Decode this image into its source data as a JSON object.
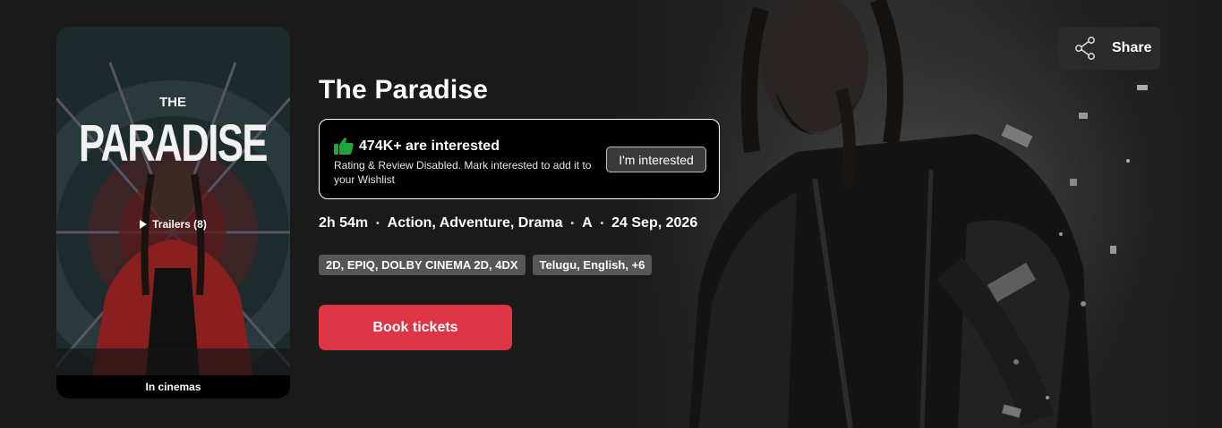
{
  "movie": {
    "title": "The Paradise",
    "poster": {
      "title_top": "THE",
      "title_main": "PARADISE",
      "trailers_label": "Trailers (8)",
      "footer_label": "In cinemas"
    },
    "interest": {
      "count_text": "474K+ are interested",
      "description": "Rating & Review Disabled. Mark interested to add it to your Wishlist",
      "button_label": "I'm interested"
    },
    "meta": {
      "duration": "2h 54m",
      "genres": "Action, Adventure, Drama",
      "certificate": "A",
      "release_date": "24 Sep, 2026",
      "separator": "•"
    },
    "tags": {
      "formats": "2D, EPIQ, DOLBY CINEMA 2D, 4DX",
      "languages": "Telugu, English, +6"
    },
    "book_button_label": "Book tickets"
  },
  "share": {
    "label": "Share",
    "icon": "share-icon"
  },
  "colors": {
    "accent": "#dc3545",
    "thumb_green": "#1ea83c",
    "background": "#1a1a1a",
    "tag_bg": "#565656"
  }
}
